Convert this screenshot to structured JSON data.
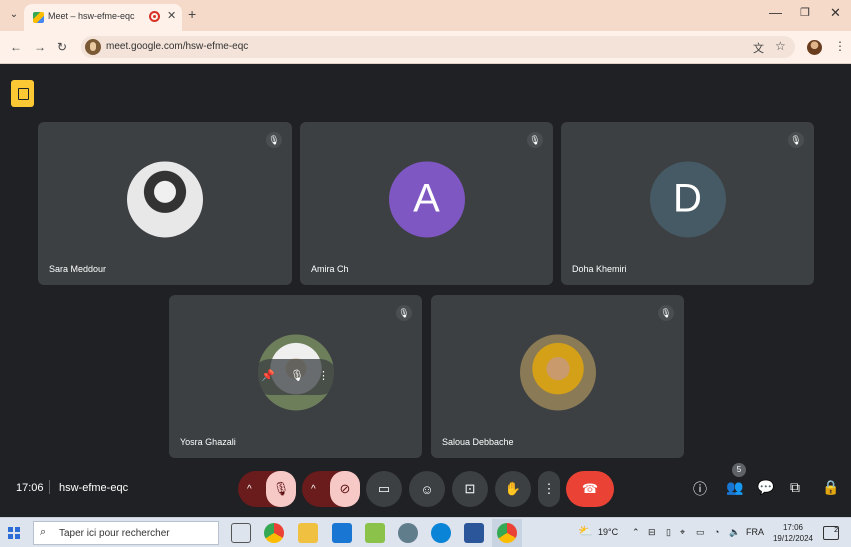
{
  "browser": {
    "tab_title": "Meet – hsw-efme-eqc",
    "url": "meet.google.com/hsw-efme-eqc",
    "icons": [
      "tab-search-icon",
      "meet-favicon",
      "recording-icon",
      "close-icon",
      "plus-icon",
      "minimize-icon",
      "restore-icon",
      "close-window-icon",
      "back-icon",
      "forward-icon",
      "reload-icon",
      "translate-icon",
      "star-icon",
      "profile-avatar",
      "more-icon"
    ]
  },
  "meet": {
    "participants": [
      {
        "name": "Sara Meddour",
        "avatar_type": "photo",
        "avatar_letter": ""
      },
      {
        "name": "Amira Ch",
        "avatar_type": "letter",
        "avatar_letter": "A",
        "color": "#7e57c2"
      },
      {
        "name": "Doha Khemiri",
        "avatar_type": "letter",
        "avatar_letter": "D",
        "color": "#455a64"
      },
      {
        "name": "Yosra Ghazali",
        "avatar_type": "photo",
        "avatar_letter": ""
      },
      {
        "name": "Saloua Debbache",
        "avatar_type": "photo",
        "avatar_letter": ""
      }
    ],
    "time": "17:06",
    "meeting_code": "hsw-efme-eqc",
    "people_count": "5"
  },
  "taskbar": {
    "search_placeholder": "Taper ici pour rechercher",
    "temperature": "19°C",
    "language": "FRA",
    "time": "17:06",
    "date": "19/12/2024",
    "notification_count": "2"
  }
}
